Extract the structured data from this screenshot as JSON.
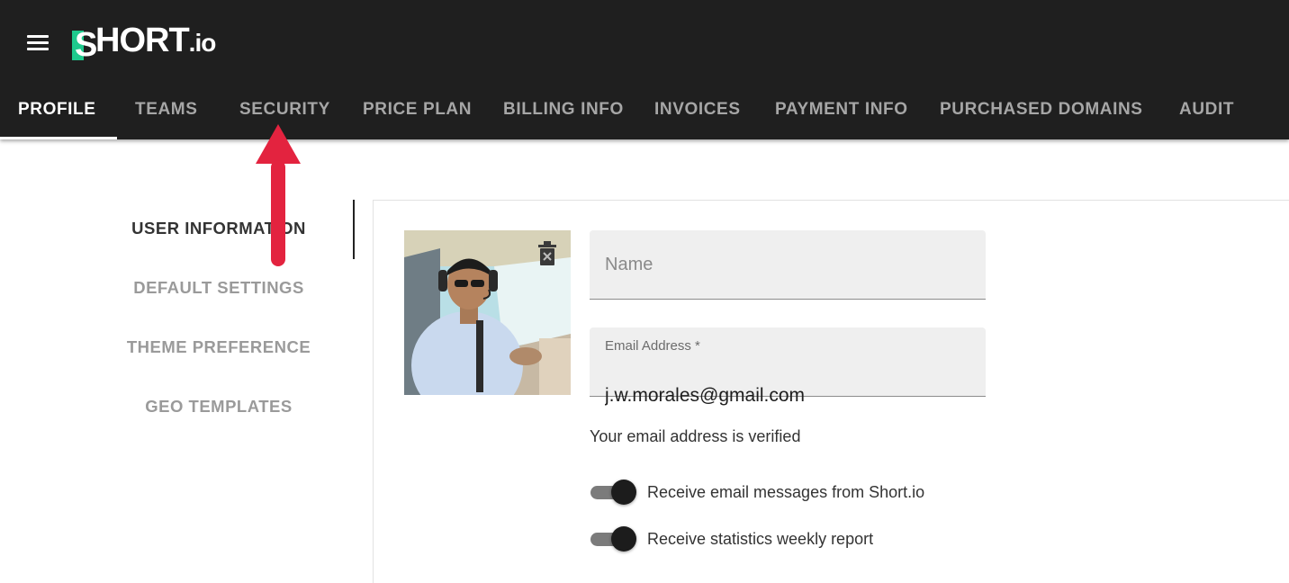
{
  "app": {
    "logo_s": "S",
    "logo_main": "HORT",
    "logo_dot": ".",
    "logo_io": "io",
    "brand_accent": "#1ec98d",
    "appbar_color": "#1f1f1f"
  },
  "tabs": [
    {
      "label": "PROFILE",
      "active": true
    },
    {
      "label": "TEAMS",
      "active": false
    },
    {
      "label": "SECURITY",
      "active": false
    },
    {
      "label": "PRICE PLAN",
      "active": false
    },
    {
      "label": "BILLING INFO",
      "active": false
    },
    {
      "label": "INVOICES",
      "active": false
    },
    {
      "label": "PAYMENT INFO",
      "active": false
    },
    {
      "label": "PURCHASED DOMAINS",
      "active": false
    },
    {
      "label": "AUDIT",
      "active": false
    }
  ],
  "sidebar": {
    "items": [
      {
        "label": "USER INFORMATION",
        "active": true
      },
      {
        "label": "DEFAULT SETTINGS",
        "active": false
      },
      {
        "label": "THEME PREFERENCE",
        "active": false
      },
      {
        "label": "GEO TEMPLATES",
        "active": false
      }
    ]
  },
  "profile": {
    "name_placeholder": "Name",
    "name_value": "",
    "email_label": "Email Address *",
    "email_value": "j.w.morales@gmail.com",
    "verified_text": "Your email address is verified",
    "toggles": [
      {
        "label": "Receive email messages from Short.io",
        "on": true
      },
      {
        "label": "Receive statistics weekly report",
        "on": true
      }
    ]
  },
  "annotation": {
    "arrow_color": "#e3233f"
  },
  "icons": {
    "menu": "hamburger-menu-icon",
    "delete_avatar": "trash-icon",
    "annotation": "arrow-up-icon"
  }
}
